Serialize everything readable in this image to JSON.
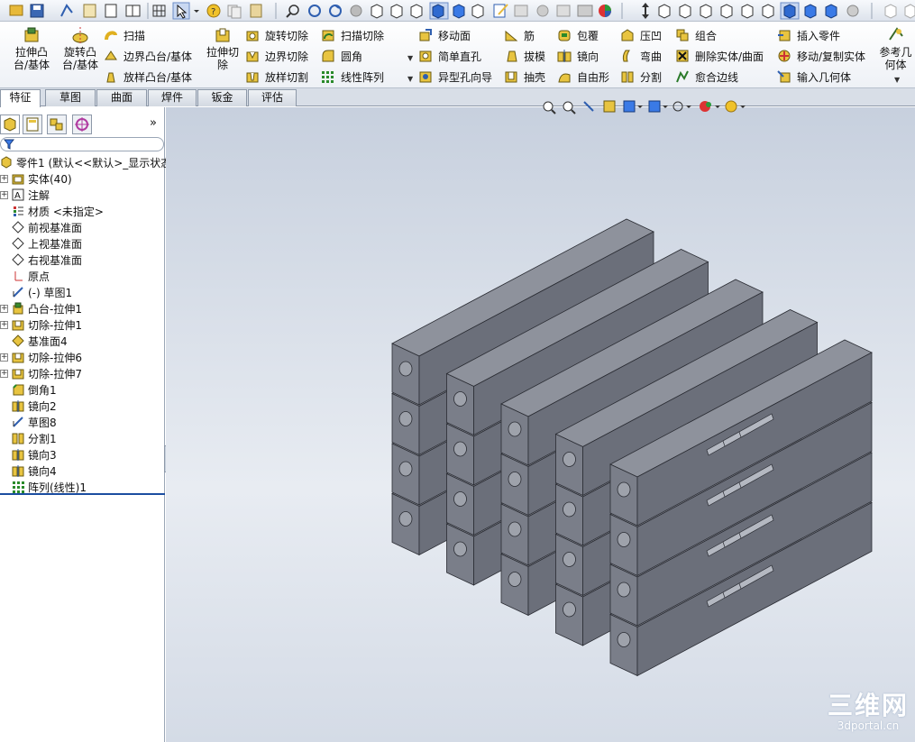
{
  "command_manager": {
    "extruded_boss": "拉伸凸\n台/基体",
    "revolved_boss": "旋转凸\n台/基体",
    "sweep": "扫描",
    "boundary_boss": "边界凸台/基体",
    "loft_boss": "放样凸台/基体",
    "extruded_cut": "拉伸切\n除",
    "revolved_cut": "旋转切除",
    "boundary_cut": "边界切除",
    "lofted_cut": "放样切割",
    "swept_cut": "扫描切除",
    "fillet": "圆角",
    "linear_pattern": "线性阵列",
    "move_face": "移动面",
    "simple_hole": "简单直孔",
    "hole_wizard": "异型孔向导",
    "rib": "筋",
    "draft": "拔模",
    "shell": "抽壳",
    "wrap": "包覆",
    "mirror": "镜向",
    "freeform": "自由形",
    "indent": "压凹",
    "flex": "弯曲",
    "split": "分割",
    "combine": "组合",
    "delete_body": "删除实体/曲面",
    "knit_edge": "愈合边线",
    "insert_part": "插入零件",
    "move_copy_body": "移动/复制实体",
    "import_geometry": "输入几何体",
    "reference_geometry": "参考几\n何体"
  },
  "tabs": [
    {
      "label": "特征",
      "active": true
    },
    {
      "label": "草图",
      "active": false
    },
    {
      "label": "曲面",
      "active": false
    },
    {
      "label": "焊件",
      "active": false
    },
    {
      "label": "钣金",
      "active": false
    },
    {
      "label": "评估",
      "active": false
    }
  ],
  "feature_tree": {
    "root": "零件1  (默认<<默认>_显示状态",
    "items": [
      {
        "label": "实体(40)",
        "icon": "solid-bodies-folder-icon",
        "expandable": true
      },
      {
        "label": "注解",
        "icon": "annotations-icon",
        "expandable": true
      },
      {
        "label": "材质 <未指定>",
        "icon": "material-icon",
        "expandable": false
      },
      {
        "label": "前视基准面",
        "icon": "plane-icon",
        "expandable": false
      },
      {
        "label": "上视基准面",
        "icon": "plane-icon",
        "expandable": false
      },
      {
        "label": "右视基准面",
        "icon": "plane-icon",
        "expandable": false
      },
      {
        "label": "原点",
        "icon": "origin-icon",
        "expandable": false
      },
      {
        "label": "(-) 草图1",
        "icon": "sketch-icon",
        "expandable": false
      },
      {
        "label": "凸台-拉伸1",
        "icon": "boss-extrude-icon",
        "expandable": true
      },
      {
        "label": "切除-拉伸1",
        "icon": "cut-extrude-icon",
        "expandable": true
      },
      {
        "label": "基准面4",
        "icon": "plane-yellow-icon",
        "expandable": false
      },
      {
        "label": "切除-拉伸6",
        "icon": "cut-extrude-icon",
        "expandable": true
      },
      {
        "label": "切除-拉伸7",
        "icon": "cut-extrude-icon",
        "expandable": true
      },
      {
        "label": "倒角1",
        "icon": "chamfer-icon",
        "expandable": false
      },
      {
        "label": "镜向2",
        "icon": "mirror-icon",
        "expandable": false
      },
      {
        "label": "草图8",
        "icon": "sketch-icon",
        "expandable": false
      },
      {
        "label": "分割1",
        "icon": "split-icon",
        "expandable": false
      },
      {
        "label": "镜向3",
        "icon": "mirror-icon",
        "expandable": false
      },
      {
        "label": "镜向4",
        "icon": "mirror-icon",
        "expandable": false
      },
      {
        "label": "阵列(线性)1",
        "icon": "linear-pattern-icon",
        "expandable": false
      }
    ]
  },
  "watermark": {
    "text": "三维网",
    "url": "3dportal.cn"
  },
  "colors": {
    "model_face_top": "#8e929c",
    "model_face_front": "#7a7e89",
    "model_face_side": "#6b6f7a",
    "accent": "#1b4da0"
  }
}
